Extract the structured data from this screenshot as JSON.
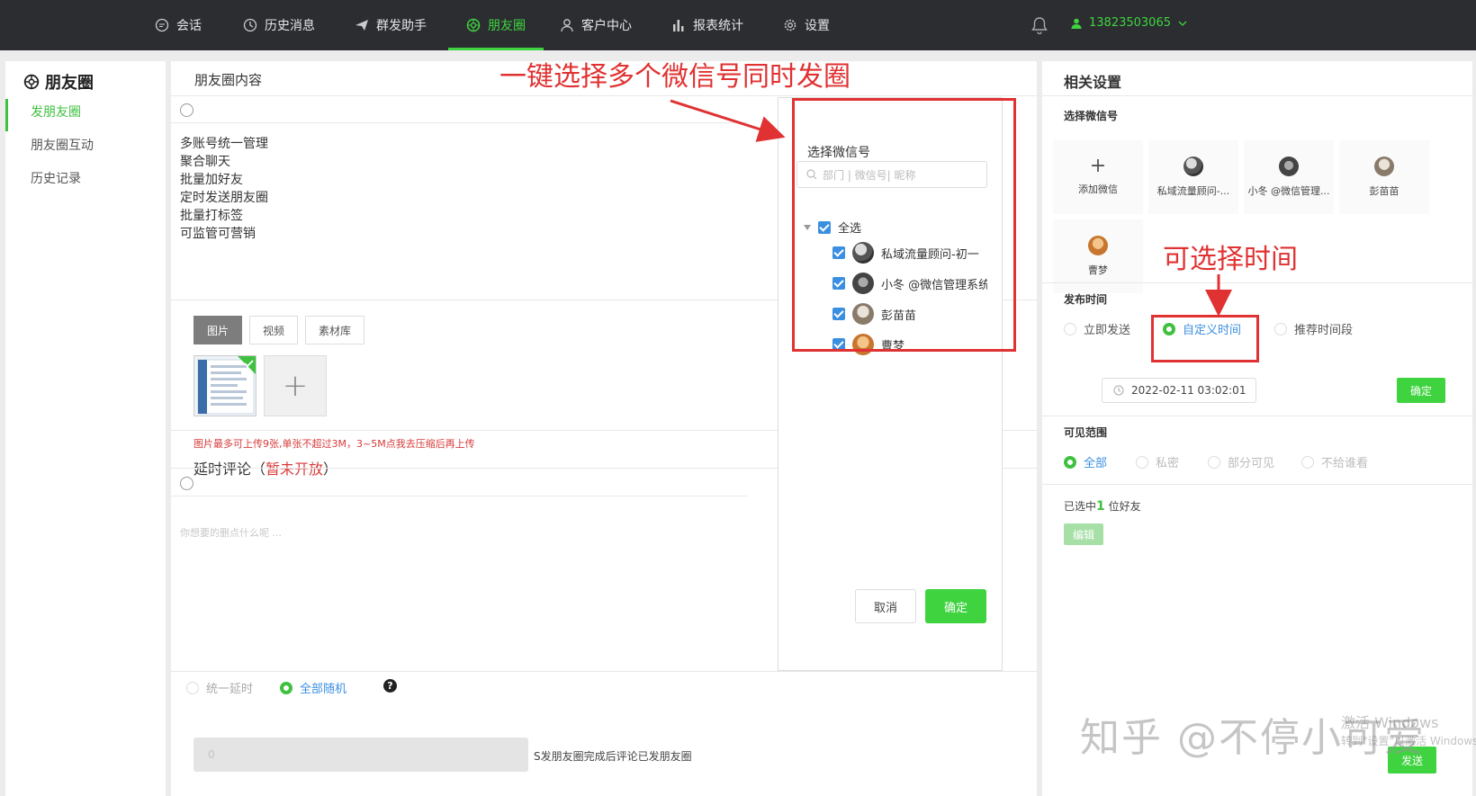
{
  "nav": {
    "items": [
      {
        "label": "会话",
        "icon": "chat-icon"
      },
      {
        "label": "历史消息",
        "icon": "clock-icon"
      },
      {
        "label": "群发助手",
        "icon": "send-icon"
      },
      {
        "label": "朋友圈",
        "icon": "moments-icon"
      },
      {
        "label": "客户中心",
        "icon": "user-icon"
      },
      {
        "label": "报表统计",
        "icon": "bar-chart-icon"
      },
      {
        "label": "设置",
        "icon": "gear-icon"
      }
    ],
    "active_index": 3,
    "user_phone": "13823503065"
  },
  "sidebar": {
    "title": "朋友圈",
    "items": [
      {
        "label": "发朋友圈"
      },
      {
        "label": "朋友圈互动"
      },
      {
        "label": "历史记录"
      }
    ]
  },
  "main": {
    "title": "朋友圈内容",
    "content_lines": [
      "多账号统一管理",
      "聚合聊天",
      "批量加好友",
      "定时发送朋友圈",
      "批量打标签",
      "可监管可营销"
    ],
    "media_tabs": [
      "图片",
      "视频",
      "素材库"
    ],
    "upload_tip": "图片最多可上传9张,单张不超过3M，3~5M点我去压缩后再上传",
    "delay_title": "延时评论（",
    "delay_title_red": "暂未开放",
    "delay_title_end": "）",
    "comment_placeholder": "你想要的删点什么呢 ...",
    "delay_modes": [
      "统一延时",
      "全部随机"
    ],
    "help_glyph": "?",
    "delay_value": "0",
    "delay_tail": "S发朋友圈完成后评论已发朋友圈"
  },
  "chooser": {
    "title": "选择微信号",
    "search_placeholder": "部门 | 微信号| 昵称",
    "select_all": "全选",
    "accounts": [
      "私域流量顾问-初一",
      "小冬 @微信管理系统",
      "彭苗苗",
      "曹梦"
    ],
    "cancel": "取消",
    "confirm": "确定"
  },
  "annotations": {
    "top": "一键选择多个微信号同时发圈",
    "right": "可选择时间"
  },
  "settings": {
    "title": "相关设置",
    "select_label": "选择微信号",
    "add_label": "添加微信",
    "add_glyph": "+",
    "accounts": [
      "私域流量顾问-...",
      "小冬 @微信管理...",
      "彭苗苗",
      "曹梦"
    ],
    "publish_label": "发布时间",
    "publish_options": [
      "立即发送",
      "自定义时间",
      "推荐时间段"
    ],
    "publish_selected": 1,
    "datetime": "2022-02-11 03:02:01",
    "confirm": "确定",
    "visibility_label": "可见范围",
    "visibility_options": [
      "全部",
      "私密",
      "部分可见",
      "不给谁看"
    ],
    "friends_prefix": "已选中",
    "friends_count": "1",
    "friends_suffix": "位好友",
    "edit": "编辑",
    "send": "发送"
  },
  "watermark": "知乎 @不停小可爱",
  "os_activate_line1": "激活 Windows",
  "os_activate_line2": "转到\"设置\"以激活 Windows",
  "colors": {
    "accent": "#3fd43f",
    "nav_bg": "#2b2d31",
    "annotation": "#e03232",
    "link": "#3b8fe0"
  }
}
